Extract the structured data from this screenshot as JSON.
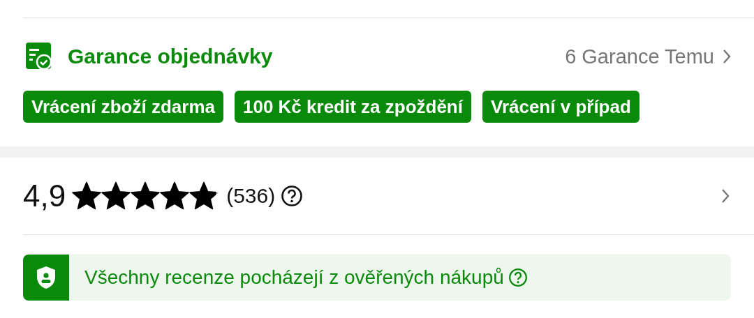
{
  "guarantee": {
    "title": "Garance objednávky",
    "link": "6 Garance Temu",
    "tags": [
      "Vrácení zboží zdarma",
      "100 Kč kredit za zpoždění",
      "Vrácení v případ"
    ]
  },
  "rating": {
    "score": "4,9",
    "stars": 4.9,
    "count": "(536)"
  },
  "notice": {
    "text": "Všechny recenze pocházejí z ověřených nákupů"
  }
}
